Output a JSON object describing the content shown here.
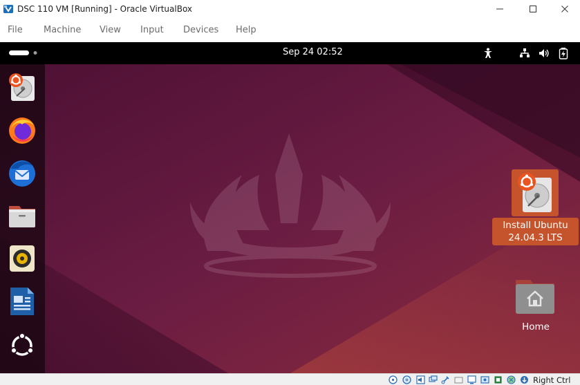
{
  "window": {
    "title": "DSC 110 VM [Running] - Oracle VirtualBox"
  },
  "menu": {
    "items": [
      "File",
      "Machine",
      "View",
      "Input",
      "Devices",
      "Help"
    ]
  },
  "guest": {
    "clock": "Sep 24  02:52",
    "tray_icons": [
      "accessibility-icon",
      "network-icon",
      "volume-icon",
      "battery-icon"
    ],
    "dock_apps": [
      "ubuntu-installer-icon",
      "firefox-icon",
      "thunderbird-icon",
      "files-icon",
      "rhythmbox-icon",
      "libreoffice-writer-icon",
      "app-grid-icon"
    ],
    "desktop_icons": [
      {
        "label_line1": "Install Ubuntu",
        "label_line2": "24.04.3 LTS",
        "selected": true
      },
      {
        "label": "Home"
      }
    ],
    "accent_color": "#c5532b",
    "wallpaper_color": "#5a1438"
  },
  "statusbar": {
    "host_key": "Right Ctrl",
    "icons": [
      "hard-disk-icon",
      "optical-disk-icon",
      "audio-icon",
      "network-adapter-icon",
      "usb-icon",
      "shared-folder-icon",
      "display-icon",
      "recording-icon",
      "cpu-icon",
      "mouse-integration-icon",
      "host-key-arrow-icon"
    ]
  }
}
